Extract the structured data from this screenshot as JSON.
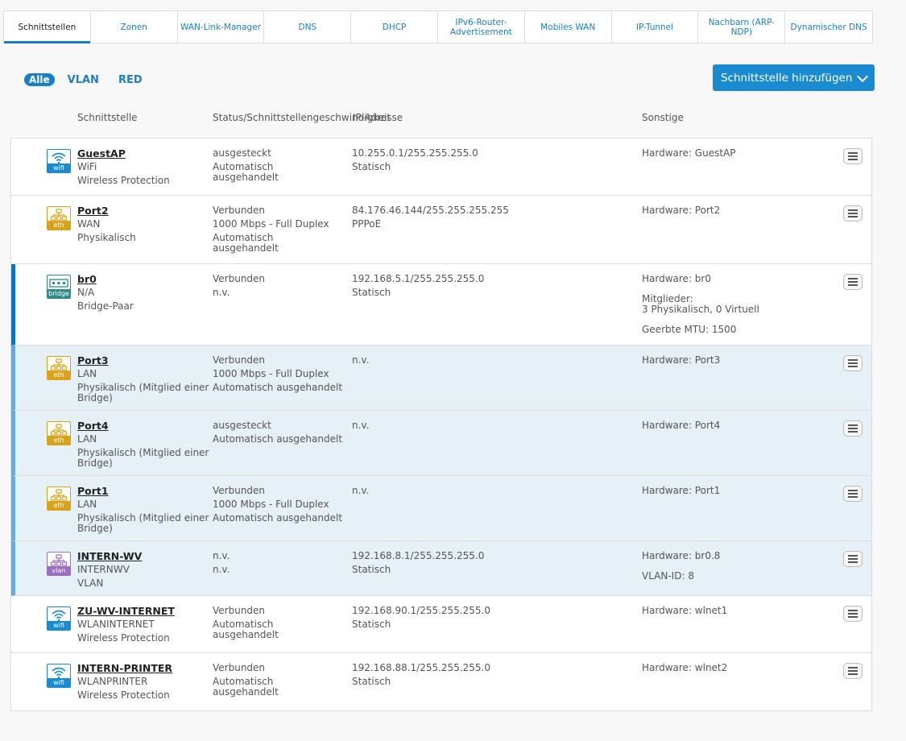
{
  "tabs": [
    "Schnittstellen",
    "Zonen",
    "WAN-Link-Manager",
    "DNS",
    "DHCP",
    "IPv6-Router-Advertisement",
    "Mobiles WAN",
    "IP-Tunnel",
    "Nachbarn (ARP-NDP)",
    "Dynamischer DNS"
  ],
  "filters": {
    "all": "Alle",
    "vlan": "VLAN",
    "red": "RED"
  },
  "add_button": "Schnittstelle hinzufügen",
  "headers": {
    "interface": "Schnittstelle",
    "status": "Status/Schnittstellengeschwindigkeit",
    "ip": "IP-Adresse",
    "other": "Sonstige"
  },
  "rows": [
    {
      "icon": "wifi",
      "icon_label": "wifi",
      "name": "GuestAP",
      "sub": [
        "WiFi",
        "Wireless Protection"
      ],
      "status": [
        "ausgesteckt",
        "Automatisch",
        "ausgehandelt"
      ],
      "ip": [
        "10.255.0.1/255.255.255.0",
        "Statisch"
      ],
      "other": [
        "Hardware:  GuestAP"
      ]
    },
    {
      "icon": "eth",
      "icon_label": "eth",
      "name": "Port2",
      "sub": [
        "WAN",
        "Physikalisch"
      ],
      "status": [
        "Verbunden",
        "1000 Mbps - Full Duplex",
        "Automatisch",
        "ausgehandelt"
      ],
      "ip": [
        "84.176.46.144/255.255.255.255",
        "PPPoE"
      ],
      "other": [
        "Hardware:  Port2"
      ]
    },
    {
      "icon": "bridge",
      "icon_label": "bridge",
      "name": "br0",
      "sub": [
        "N/A",
        "Bridge-Paar"
      ],
      "status": [
        "Verbunden",
        "n.v."
      ],
      "ip": [
        "192.168.5.1/255.255.255.0",
        "Statisch"
      ],
      "other": [
        "Hardware:  br0",
        "Mitglieder:",
        "3 Physikalisch, 0 Virtuell",
        "Geerbte MTU: 1500"
      ]
    },
    {
      "icon": "eth",
      "icon_label": "eth",
      "name": "Port3",
      "sub": [
        "LAN",
        "Physikalisch (Mitglied einer",
        "Bridge)"
      ],
      "status": [
        "Verbunden",
        "1000 Mbps - Full Duplex",
        "Automatisch ausgehandelt"
      ],
      "ip": [
        "n.v."
      ],
      "other": [
        "Hardware:  Port3"
      ]
    },
    {
      "icon": "eth",
      "icon_label": "eth",
      "name": "Port4",
      "sub": [
        "LAN",
        "Physikalisch (Mitglied einer",
        "Bridge)"
      ],
      "status": [
        "ausgesteckt",
        "Automatisch ausgehandelt"
      ],
      "ip": [
        "n.v."
      ],
      "other": [
        "Hardware:  Port4"
      ]
    },
    {
      "icon": "eth",
      "icon_label": "eth",
      "name": "Port1",
      "sub": [
        "LAN",
        "Physikalisch (Mitglied einer",
        "Bridge)"
      ],
      "status": [
        "Verbunden",
        "1000 Mbps - Full Duplex",
        "Automatisch ausgehandelt"
      ],
      "ip": [
        "n.v."
      ],
      "other": [
        "Hardware:  Port1"
      ]
    },
    {
      "icon": "vlan",
      "icon_label": "vlan",
      "name": "INTERN-WV",
      "sub": [
        "INTERNWV",
        "VLAN"
      ],
      "status": [
        "n.v.",
        "n.v."
      ],
      "ip": [
        "192.168.8.1/255.255.255.0",
        "Statisch"
      ],
      "other": [
        "Hardware:  br0.8",
        "VLAN-ID: 8"
      ]
    },
    {
      "icon": "wifi",
      "icon_label": "wifi",
      "name": "ZU-WV-INTERNET",
      "sub": [
        "WLANINTERNET",
        "Wireless Protection"
      ],
      "status": [
        "Verbunden",
        "Automatisch",
        "ausgehandelt"
      ],
      "ip": [
        "192.168.90.1/255.255.255.0",
        "Statisch"
      ],
      "other": [
        "Hardware:  wlnet1"
      ]
    },
    {
      "icon": "wifi",
      "icon_label": "wifi",
      "name": "INTERN-PRINTER",
      "sub": [
        "WLANPRINTER",
        "Wireless Protection"
      ],
      "status": [
        "Verbunden",
        "Automatisch",
        "ausgehandelt"
      ],
      "ip": [
        "192.168.88.1/255.255.255.0",
        "Statisch"
      ],
      "other": [
        "Hardware:  wlnet2"
      ]
    }
  ]
}
